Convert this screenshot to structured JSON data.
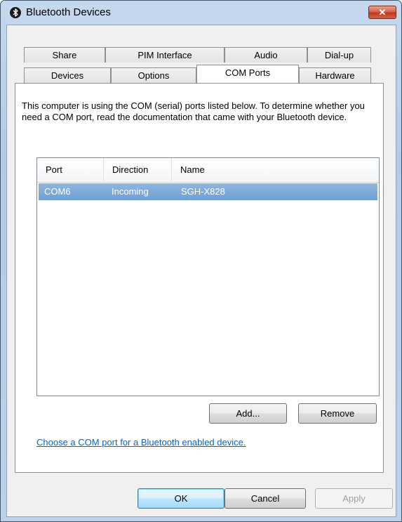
{
  "window": {
    "title": "Bluetooth Devices",
    "close_glyph": "✕"
  },
  "tabs": {
    "row_back": [
      "Share",
      "PIM Interface",
      "Audio",
      "Dial-up"
    ],
    "row_front": [
      "Devices",
      "Options",
      "COM Ports",
      "Hardware"
    ],
    "active": "COM Ports"
  },
  "com_ports": {
    "description": "This computer is using the COM (serial) ports listed below. To determine whether you need a COM port, read the documentation that came with your Bluetooth device.",
    "columns": [
      "Port",
      "Direction",
      "Name"
    ],
    "rows": [
      {
        "port": "COM6",
        "direction": "Incoming",
        "name": "SGH-X828",
        "selected": true
      }
    ],
    "add_label": "Add...",
    "remove_label": "Remove",
    "help_link": "Choose a COM port for a Bluetooth enabled device."
  },
  "footer": {
    "ok_label": "OK",
    "cancel_label": "Cancel",
    "apply_label": "Apply"
  },
  "colors": {
    "selection": "#7aa8d9",
    "link": "#0066cc",
    "close_button": "#c2391d"
  },
  "icons": {
    "title_icon": "bluetooth-icon",
    "close": "close-icon"
  }
}
